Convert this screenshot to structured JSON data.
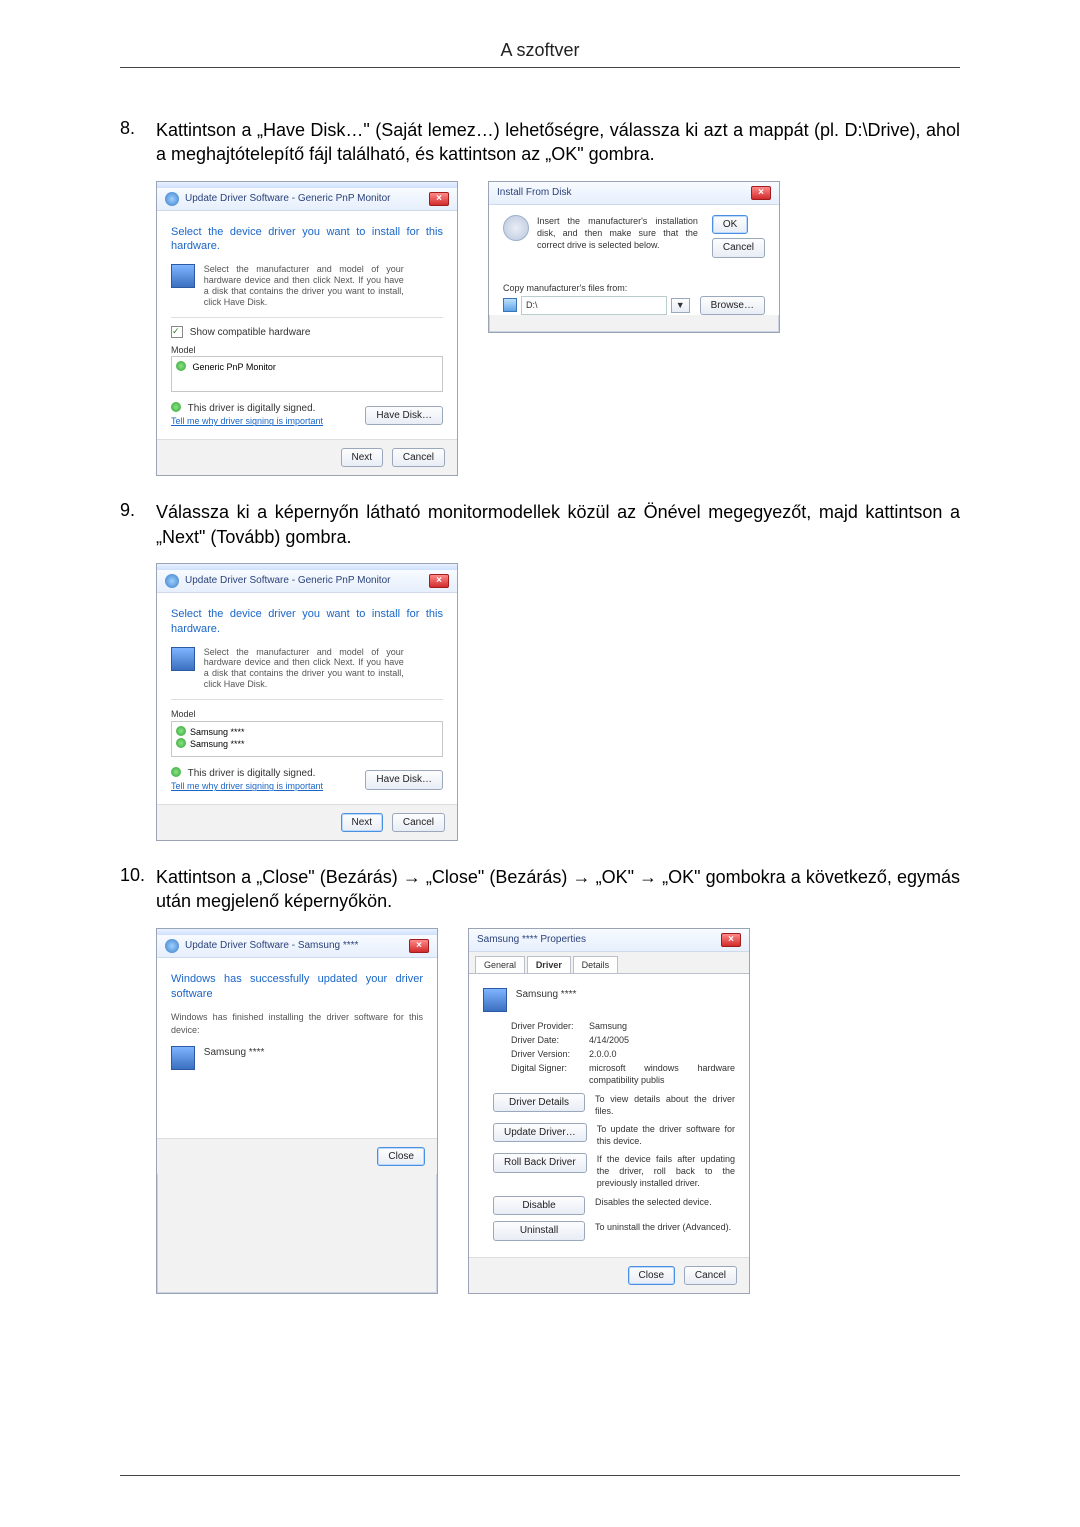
{
  "header": {
    "title": "A szoftver"
  },
  "steps": [
    {
      "num": "8.",
      "text": "Kattintson a „Have Disk…\" (Saját lemez…) lehetőségre, válassza ki azt a mappát (pl. D:\\Drive), ahol a meghajtótelepítő fájl található, és kattintson az „OK\" gombra."
    },
    {
      "num": "9.",
      "text": "Válassza ki a képernyőn látható monitormodellek közül az Önével megegyezőt, majd kattintson a „Next\" (Tovább) gombra."
    },
    {
      "num": "10.",
      "text": "Kattintson a „Close\" (Bezárás) → „Close\" (Bezárás) → „OK\" → „OK\" gombokra a következő, egymás után megjelenő képernyőkön."
    }
  ],
  "dlg_wiz1": {
    "title": "Update Driver Software - Generic PnP Monitor",
    "close_x": "×",
    "heading": "Select the device driver you want to install for this hardware.",
    "hint": "Select the manufacturer and model of your hardware device and then click Next. If you have a disk that contains the driver you want to install, click Have Disk.",
    "compat_cb": "Show compatible hardware",
    "model_label": "Model",
    "model_item": "Generic PnP Monitor",
    "signed": "This driver is digitally signed.",
    "signed_link": "Tell me why driver signing is important",
    "have_disk": "Have Disk…",
    "next": "Next",
    "cancel": "Cancel"
  },
  "dlg_ifd": {
    "title": "Install From Disk",
    "close_x": "×",
    "msg": "Insert the manufacturer's installation disk, and then make sure that the correct drive is selected below.",
    "ok": "OK",
    "cancel": "Cancel",
    "copy_label": "Copy manufacturer's files from:",
    "path": "D:\\",
    "browse": "Browse…"
  },
  "dlg_wiz2": {
    "title": "Update Driver Software - Generic PnP Monitor",
    "close_x": "×",
    "heading": "Select the device driver you want to install for this hardware.",
    "hint": "Select the manufacturer and model of your hardware device and then click Next. If you have a disk that contains the driver you want to install, click Have Disk.",
    "model_label": "Model",
    "model_item1": "Samsung ****",
    "model_item2": "Samsung ****",
    "signed": "This driver is digitally signed.",
    "signed_link": "Tell me why driver signing is important",
    "have_disk": "Have Disk…",
    "next": "Next",
    "cancel": "Cancel"
  },
  "dlg_done": {
    "title": "Update Driver Software - Samsung ****",
    "close_x": "×",
    "heading": "Windows has successfully updated your driver software",
    "sub": "Windows has finished installing the driver software for this device:",
    "device": "Samsung ****",
    "close": "Close"
  },
  "dlg_props": {
    "title": "Samsung **** Properties",
    "close_x": "×",
    "tabs": {
      "general": "General",
      "driver": "Driver",
      "details": "Details"
    },
    "device": "Samsung ****",
    "provider_k": "Driver Provider:",
    "provider_v": "Samsung",
    "date_k": "Driver Date:",
    "date_v": "4/14/2005",
    "version_k": "Driver Version:",
    "version_v": "2.0.0.0",
    "signer_k": "Digital Signer:",
    "signer_v": "microsoft windows hardware compatibility publis",
    "btn_details": "Driver Details",
    "desc_details": "To view details about the driver files.",
    "btn_update": "Update Driver…",
    "desc_update": "To update the driver software for this device.",
    "btn_rollback": "Roll Back Driver",
    "desc_rollback": "If the device fails after updating the driver, roll back to the previously installed driver.",
    "btn_disable": "Disable",
    "desc_disable": "Disables the selected device.",
    "btn_uninstall": "Uninstall",
    "desc_uninstall": "To uninstall the driver (Advanced).",
    "close": "Close",
    "cancel": "Cancel"
  }
}
